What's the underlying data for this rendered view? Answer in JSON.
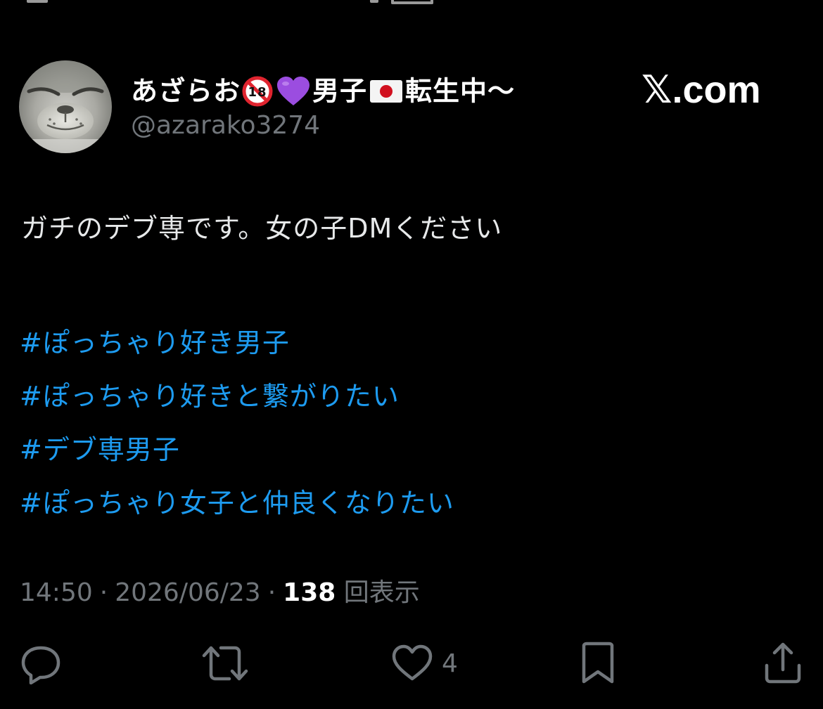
{
  "user": {
    "display_name_part1": "あざらお",
    "display_name_part2": "男子",
    "display_name_part3": "転生中〜",
    "handle": "@azarako3274",
    "badge_text": "18"
  },
  "brand": {
    "x_glyph": "𝕏",
    "suffix": ".com"
  },
  "tweet": {
    "text": "ガチのデブ専です。女の子DMください",
    "hashtags": [
      "#ぽっちゃり好き男子",
      "#ぽっちゃり好きと繋がりたい",
      "#デブ専男子",
      "#ぽっちゃり女子と仲良くなりたい"
    ]
  },
  "meta": {
    "time": "14:50",
    "separator": "·",
    "date": "2026/06/23",
    "views_count": "138",
    "views_label": "回表示"
  },
  "actions": {
    "like_count": "4"
  },
  "colors": {
    "background": "#000000",
    "text": "#e7e9ea",
    "secondary": "#71767b",
    "link": "#1d9bf0",
    "heart_purple": "#9b4de0",
    "flag_red": "#d1101f"
  }
}
